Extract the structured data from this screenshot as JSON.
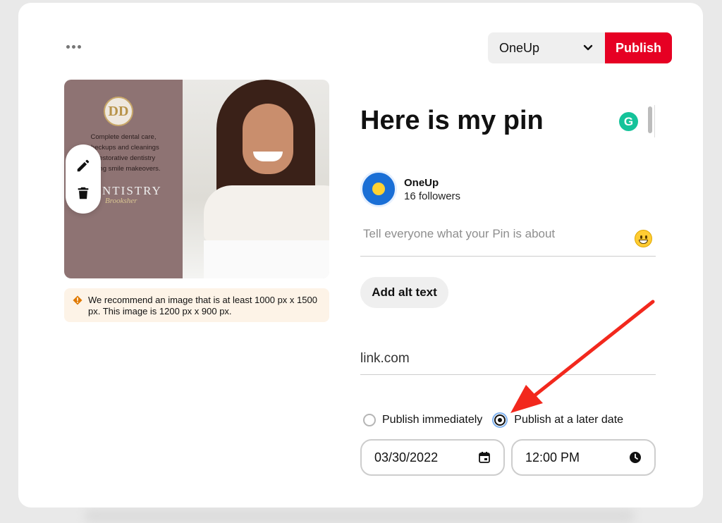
{
  "toolbar": {
    "board_selected": "OneUp",
    "publish_label": "Publish"
  },
  "image_overlay": {
    "logo_letters": "DD",
    "ad_lines": [
      "Complete dental care,",
      "checkups and cleanings",
      "x restorative dentistry",
      "anging smile makeovers."
    ],
    "brand_text": "NTISTRY",
    "brand_sub": "Brooksher"
  },
  "warning": {
    "text": "We recommend an image that is at least 1000 px x 1500 px. This image is 1200 px x 900 px."
  },
  "pin": {
    "title": "Here is my pin"
  },
  "grammarly": {
    "letter": "G"
  },
  "account": {
    "name": "OneUp",
    "followers": "16 followers"
  },
  "description": {
    "placeholder": "Tell everyone what your Pin is about",
    "value": ""
  },
  "alt_text_button": "Add alt text",
  "link": {
    "value": "link.com"
  },
  "schedule": {
    "option_now": "Publish immediately",
    "option_later": "Publish at a later date",
    "selected": "later",
    "date": "03/30/2022",
    "time": "12:00 PM"
  },
  "colors": {
    "publish_bg": "#e60023",
    "annotation_arrow": "#f2281d",
    "grammarly": "#15c39a",
    "warning_bg": "#fdf3e7",
    "warning_icon": "#e07900"
  },
  "icons": [
    "more-icon",
    "chevron-down-icon",
    "pencil-icon",
    "trash-icon",
    "warning-icon",
    "grammarly-icon",
    "emoji-icon",
    "calendar-icon",
    "clock-icon"
  ]
}
